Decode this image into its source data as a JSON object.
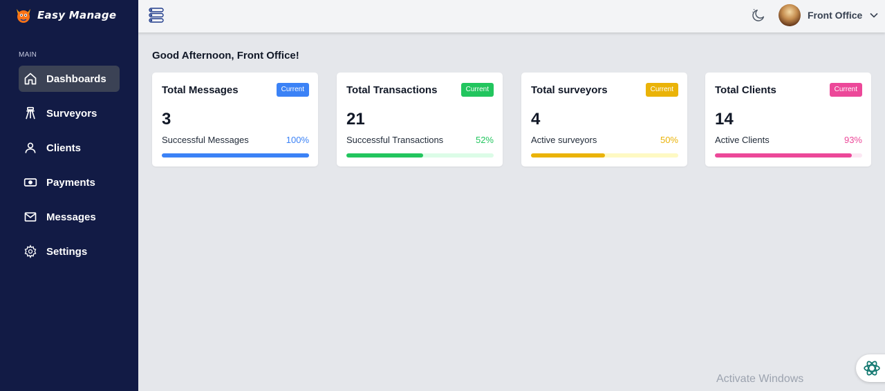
{
  "brand": {
    "name": "Easy Manage"
  },
  "sidebar": {
    "section": "MAIN",
    "items": [
      {
        "label": "Dashboards",
        "icon": "home-icon",
        "active": true
      },
      {
        "label": "Surveyors",
        "icon": "tripod-icon"
      },
      {
        "label": "Clients",
        "icon": "user-icon"
      },
      {
        "label": "Payments",
        "icon": "payment-icon"
      },
      {
        "label": "Messages",
        "icon": "mail-icon"
      },
      {
        "label": "Settings",
        "icon": "gear-icon"
      }
    ]
  },
  "header": {
    "user_name": "Front Office",
    "icons": [
      "menu-toggle-icon",
      "moon-icon",
      "chevron-down-icon"
    ]
  },
  "greeting": "Good Afternoon, Front Office!",
  "cards": [
    {
      "title": "Total Messages",
      "badge": "Current",
      "value": "3",
      "sub": "Successful Messages",
      "pct": "100%",
      "progress": 100,
      "color": "#3b82f6",
      "track": "#dbeafe"
    },
    {
      "title": "Total Transactions",
      "badge": "Current",
      "value": "21",
      "sub": "Successful Transactions",
      "pct": "52%",
      "progress": 52,
      "color": "#22c55e",
      "track": "#dcfce7"
    },
    {
      "title": "Total surveyors",
      "badge": "Current",
      "value": "4",
      "sub": "Active surveyors",
      "pct": "50%",
      "progress": 50,
      "color": "#eab308",
      "track": "#fef9c3"
    },
    {
      "title": "Total Clients",
      "badge": "Current",
      "value": "14",
      "sub": "Active Clients",
      "pct": "93%",
      "progress": 93,
      "color": "#ec4899",
      "track": "#fce7f3"
    }
  ],
  "watermark": "Activate Windows"
}
